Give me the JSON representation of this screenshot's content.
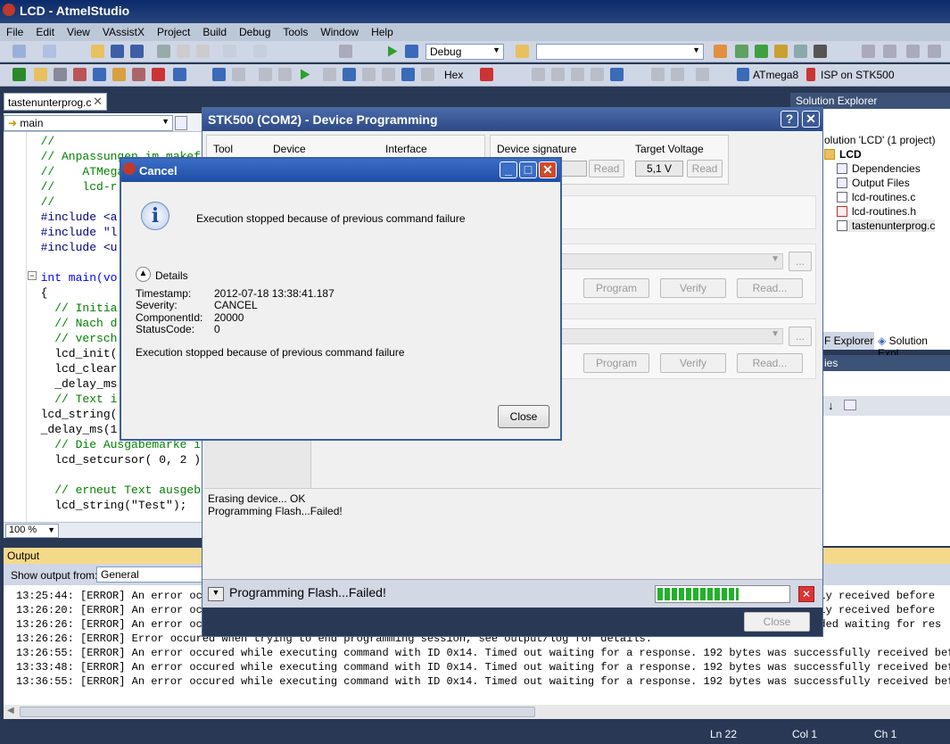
{
  "app": {
    "title": "LCD - AtmelStudio"
  },
  "menu": [
    "File",
    "Edit",
    "View",
    "VAssistX",
    "Project",
    "Build",
    "Debug",
    "Tools",
    "Window",
    "Help"
  ],
  "toolbar": {
    "config": "Debug",
    "hex_label": "Hex",
    "device": "ATmega8",
    "tool": "ISP on STK500"
  },
  "editor": {
    "tab": "tastenunterprog.c",
    "nav": "main",
    "zoom": "100 %",
    "lines": [
      {
        "t": "  //",
        "c": "cm"
      },
      {
        "t": "  // Anpassungen im makefil",
        "c": "cm"
      },
      {
        "t": "  //    ATMega",
        "c": "cm"
      },
      {
        "t": "  //    lcd-r",
        "c": "cm"
      },
      {
        "t": "  //",
        "c": "cm"
      },
      {
        "t": "  #include <a",
        "c": "pp"
      },
      {
        "t": "  #include \"l",
        "c": "pp"
      },
      {
        "t": "  #include <u",
        "c": "pp"
      },
      {
        "t": "",
        "c": ""
      },
      {
        "t": "  int main(vo",
        "c": "kw"
      },
      {
        "t": "  {",
        "c": ""
      },
      {
        "t": "    // Initia",
        "c": "cm"
      },
      {
        "t": "    // Nach d",
        "c": "cm"
      },
      {
        "t": "    // versch",
        "c": "cm"
      },
      {
        "t": "    lcd_init(",
        "c": ""
      },
      {
        "t": "    lcd_clear",
        "c": ""
      },
      {
        "t": "    _delay_ms",
        "c": ""
      },
      {
        "t": "    // Text i",
        "c": "cm"
      },
      {
        "t": "  lcd_string(",
        "c": ""
      },
      {
        "t": "  _delay_ms(1",
        "c": ""
      },
      {
        "t": "    // Die Ausgabemarke i",
        "c": "cm"
      },
      {
        "t": "    lcd_setcursor( 0, 2 )",
        "c": ""
      },
      {
        "t": "",
        "c": ""
      },
      {
        "t": "    // erneut Text ausgeb",
        "c": "cm"
      },
      {
        "t": "    lcd_string(\"Test\");",
        "c": ""
      }
    ]
  },
  "output": {
    "title": "Output",
    "show_label": "Show output from:",
    "source": "General",
    "lines": [
      "13:25:44: [ERROR] An error occu",
      "13:26:20: [ERROR] An error occ",
      "13:26:26: [ERROR] An error occ",
      "13:26:26: [ERROR] Error occured when trying to end programming session, see output/log for details.",
      "13:26:55: [ERROR] An error occured while executing command with ID 0x14. Timed out waiting for a response. 192 bytes was successfully received before",
      "13:33:48: [ERROR] An error occured while executing command with ID 0x14. Timed out waiting for a response. 192 bytes was successfully received before",
      "13:36:55: [ERROR] An error occured while executing command with ID 0x14. Timed out waiting for a response. 192 bytes was successfully received before"
    ],
    "right_frag": [
      "ully received before",
      "ully received before",
      "arded waiting for res"
    ]
  },
  "statusbar": {
    "ln": "Ln 22",
    "col": "Col 1",
    "ch": "Ch 1"
  },
  "solution": {
    "title": "Solution Explorer",
    "items": [
      "olution 'LCD' (1 project)",
      "LCD",
      "Dependencies",
      "Output Files",
      "lcd-routines.c",
      "lcd-routines.h",
      "tastenunterprog.c"
    ],
    "tab_left": "F Explorer",
    "tab_right": "Solution Expl",
    "props": "ies"
  },
  "device_dialog": {
    "title": "STK500 (COM2) - Device Programming",
    "col_tool": "Tool",
    "col_device": "Device",
    "col_interface": "Interface",
    "sig_label": "Device signature",
    "volt_label": "Target Voltage",
    "voltage": "5,1 V",
    "read": "Read",
    "program": "Program",
    "verify": "Verify",
    "readdots": "Read...",
    "dots": "...",
    "log": [
      "Erasing device... OK",
      "Programming Flash...Failed!"
    ],
    "status": "Programming Flash...Failed!",
    "progress": 0.62,
    "close": "Close"
  },
  "cancel_dialog": {
    "title": "Cancel",
    "message": "Execution stopped because of previous command failure",
    "details": "Details",
    "fields": [
      {
        "k": "Timestamp:",
        "v": "2012-07-18 13:38:41.187"
      },
      {
        "k": "Severity:",
        "v": "CANCEL"
      },
      {
        "k": "ComponentId:",
        "v": "20000"
      },
      {
        "k": "StatusCode:",
        "v": "0"
      }
    ],
    "detail_msg": "Execution stopped because of previous command failure",
    "close": "Close"
  }
}
